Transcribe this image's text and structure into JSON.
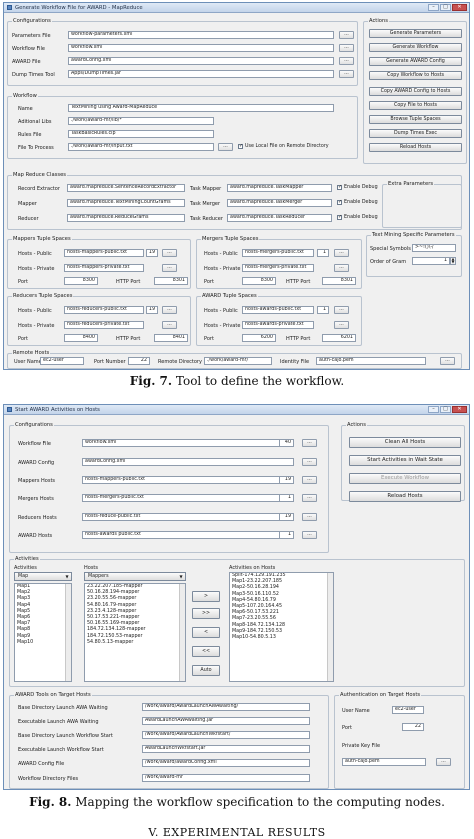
{
  "fig7": {
    "title": "Generate Workflow File for AWARD - MapReduce",
    "configurations": {
      "legend": "Configurations",
      "rows": [
        {
          "label": "Parameters File",
          "value": "workflow-parameters.xml"
        },
        {
          "label": "Workflow File",
          "value": "workflow.xml"
        },
        {
          "label": "AWARD File",
          "value": "awardConfig.xml"
        },
        {
          "label": "Dump Times Tool",
          "value": "Apps/DumpTimes.jar"
        }
      ],
      "dots": "..."
    },
    "actions": {
      "legend": "Actions",
      "buttons": [
        "Generate Parameters",
        "Generate Workflow",
        "Generate AWARD Config",
        "Copy Workflow to Hosts",
        "Copy AWARD Config to Hosts",
        "Copy File to Hosts",
        "Browse Tuple Spaces",
        "Dump Times Exec",
        "Reload Hosts"
      ]
    },
    "workflow": {
      "legend": "Workflow",
      "rows": [
        {
          "label": "Name",
          "value": "TextMining using Award-MapReduce"
        },
        {
          "label": "Aditional Libs",
          "value": "./work/award-mr/lib/*"
        },
        {
          "label": "Rules File",
          "value": "TaskBasicRules.clp"
        },
        {
          "label": "File To Process",
          "value": "./work/award-mr/input.txt"
        }
      ],
      "local_check": "Use Local File on Remote Directory"
    },
    "mapreduce": {
      "legend": "Map Reduce Classes",
      "rows": [
        {
          "label": "Record Extractor",
          "value": "award.mapreduce.SentenceRecordExtractor",
          "task_label": "Task Mapper",
          "task_value": "award.mapreduce.TaskMapper"
        },
        {
          "label": "Mapper",
          "value": "award.mapreduce.TextMiningCountGrams",
          "task_label": "Task Merger",
          "task_value": "award.mapreduce.TaskMerger"
        },
        {
          "label": "Reducer",
          "value": "award.mapreduce.ReduceGrams",
          "task_label": "Task Reducer",
          "task_value": "award.mapreduce.TaskReducer"
        }
      ],
      "debug": "Enable Debug"
    },
    "extra": {
      "legend": "Extra Parameters",
      "tm_legend": "Text Mining Specific Parameters",
      "special_label": "Special Symbols",
      "special_value": ">~!()\\-/",
      "order_label": "Order of Gram",
      "order_value": "1"
    },
    "mappers_ts": {
      "legend": "Mappers Tuple Spaces",
      "public_label": "Hosts - Public",
      "public_value": "hosts-mappers-public.txt",
      "public_count": "19",
      "private_label": "Hosts - Private",
      "private_value": "hosts-mappers-private.txt",
      "port_label": "Port",
      "port_value": "8300",
      "http_label": "HTTP Port",
      "http_value": "8301"
    },
    "mergers_ts": {
      "legend": "Mergers Tuple Spaces",
      "public_label": "Hosts - Public",
      "public_value": "hosts-mergers-public.txt",
      "public_count": "1",
      "private_label": "Hosts - Private",
      "private_value": "hosts-mergers-private.txt",
      "port_label": "Port",
      "port_value": "8300",
      "http_label": "HTTP Port",
      "http_value": "8301"
    },
    "reducers_ts": {
      "legend": "Reducers Tuple Spaces",
      "public_label": "Hosts - Public",
      "public_value": "hosts-reducers-public.txt",
      "public_count": "19",
      "private_label": "Hosts - Private",
      "private_value": "hosts-reducers-private.txt",
      "port_label": "Port",
      "port_value": "8400",
      "http_label": "HTTP Port",
      "http_value": "8401"
    },
    "award_ts": {
      "legend": "AWARD Tuple Spaces",
      "public_label": "Hosts - Public",
      "public_value": "hosts-awards-public.txt",
      "public_count": "1",
      "private_label": "Hosts - Private",
      "private_value": "hosts-awards-private.txt",
      "port_label": "Port",
      "port_value": "6200",
      "http_label": "HTTP Port",
      "http_value": "6201"
    },
    "remote": {
      "legend": "Remote Hosts",
      "user_label": "User Name",
      "user_value": "ec2-user",
      "port_label": "Port Number",
      "port_value": "22",
      "dir_label": "Remote Directory",
      "dir_value": "./work/award-mr/",
      "id_label": "Identity File",
      "id_value": "auth-cajo.pem"
    }
  },
  "caption7": {
    "num": "Fig. 7.",
    "text": " Tool to define the workflow."
  },
  "fig8": {
    "title": "Start AWARD Activities on Hosts",
    "configurations": {
      "legend": "Configurations",
      "rows": [
        {
          "label": "Workflow File",
          "value": "workflow.xml",
          "count": "40"
        },
        {
          "label": "AWARD Config",
          "value": "awardConfig.xml",
          "count": ""
        },
        {
          "label": "Mappers Hosts",
          "value": "hosts-mappers-public.txt",
          "count": "19"
        },
        {
          "label": "Mergers Hosts",
          "value": "hosts-mergers-public.txt",
          "count": "1"
        },
        {
          "label": "Reducers Hosts",
          "value": "hosts-reduce-public.txt",
          "count": "19"
        },
        {
          "label": "AWARD Hosts",
          "value": "hosts-awards public.txt",
          "count": "1"
        }
      ],
      "dots": "..."
    },
    "actions": {
      "legend": "Actions",
      "buttons": [
        "Clean All Hosts",
        "Start Activities in Wait State",
        "Execute Workflow",
        "Reload Hosts"
      ]
    },
    "activities": {
      "legend": "Activities",
      "col_activities": "Activities",
      "col_hosts": "Hosts",
      "col_on_hosts": "Activities on Hosts",
      "activity_select": "Map",
      "hosts_select": "Mappers",
      "activity_list": [
        "Map1",
        "Map2",
        "Map3",
        "Map4",
        "Map5",
        "Map6",
        "Map7",
        "Map8",
        "Map9",
        "Map10"
      ],
      "hosts_list": [
        "23.22.207.185-mapper",
        "50.16.28.194-mapper",
        "23.20.55.56-mapper",
        "54.80.16.79-mapper",
        "23.23.4.128-mapper",
        "50.17.53.221-mapper",
        "50.16.55.169-mapper",
        "184.72.134.128-mapper",
        "184.72.150.53-mapper",
        "54.80.5.13-mapper"
      ],
      "on_hosts_list": [
        "Split-174.129.191.235",
        "Map1-23.22.207.185",
        "Map2-50.16.28.194",
        "Map3-50.16.110.52",
        "Map4-54.80.16.79",
        "Map5-107.20.164.45",
        "Map6-50.17.53.221",
        "Map7-23.20.55.56",
        "Map8-184.72.134.128",
        "Map9-184.72.150.53",
        "Map10-54.80.5.13"
      ],
      "move_buttons": [
        ">",
        ">>",
        "<",
        "<<",
        "Auto"
      ]
    },
    "tools": {
      "legend": "AWARD Tools on Target Hosts",
      "rows": [
        {
          "label": "Base Directory Launch AWA Waiting",
          "value": "/work/award/AwardLaunchAWAwaiting/"
        },
        {
          "label": "Executable Launch AWA Waiting",
          "value": "AwardLaunchAWAwaiting.jar"
        },
        {
          "label": "Base Directory Launch Workflow Start",
          "value": "/work/award/AwardLaunchWkfstart/"
        },
        {
          "label": "Executable Launch Workflow Start",
          "value": "AwardLaunchWkfstart.jar"
        },
        {
          "label": "AWARD Config File",
          "value": "/work/award/awardConfig.xml"
        },
        {
          "label": "Workflow Directory Files",
          "value": "/work/award-mr"
        }
      ]
    },
    "auth": {
      "legend": "Authentication on Target Hosts",
      "user_label": "User Name",
      "user_value": "ec2-user",
      "port_label": "Port",
      "port_value": "22",
      "key_label": "Private Key File",
      "key_value": "auth-cajo.pem"
    }
  },
  "caption8": {
    "num": "Fig. 8.",
    "text": " Mapping the workflow specification to the computing nodes."
  },
  "next_heading": "V. EXPERIMENTAL RESULTS"
}
